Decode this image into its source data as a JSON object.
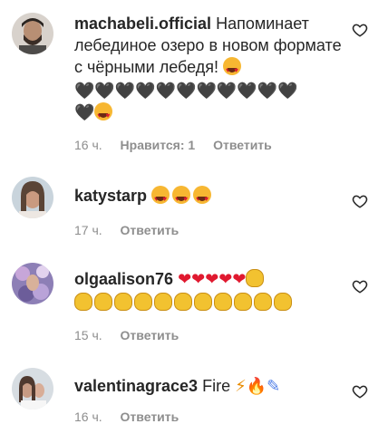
{
  "comments": [
    {
      "username": "machabeli.official",
      "text": "Напоминает лебединое озеро в новом формате с чёрными лебедя!",
      "time": "16 ч.",
      "likes": "Нравится: 1",
      "reply": "Ответить",
      "emojis": "😍 🖤×11 🖤😍"
    },
    {
      "username": "katystarp",
      "text": "",
      "time": "17 ч.",
      "reply": "Ответить",
      "emojis": "😍😍😍"
    },
    {
      "username": "olgaalison76",
      "text": "",
      "time": "15 ч.",
      "reply": "Ответить",
      "emojis": "❤×5 👏 👏×11"
    },
    {
      "username": "valentinagrace3",
      "text": "Fire",
      "time": "16 ч.",
      "reply": "Ответить",
      "emojis": "⚡🔥🧪"
    }
  ],
  "colors": {
    "text": "#262626",
    "muted": "#8e8e8e",
    "red": "#e0192f"
  },
  "icons": [
    "heart-outline-icon"
  ]
}
